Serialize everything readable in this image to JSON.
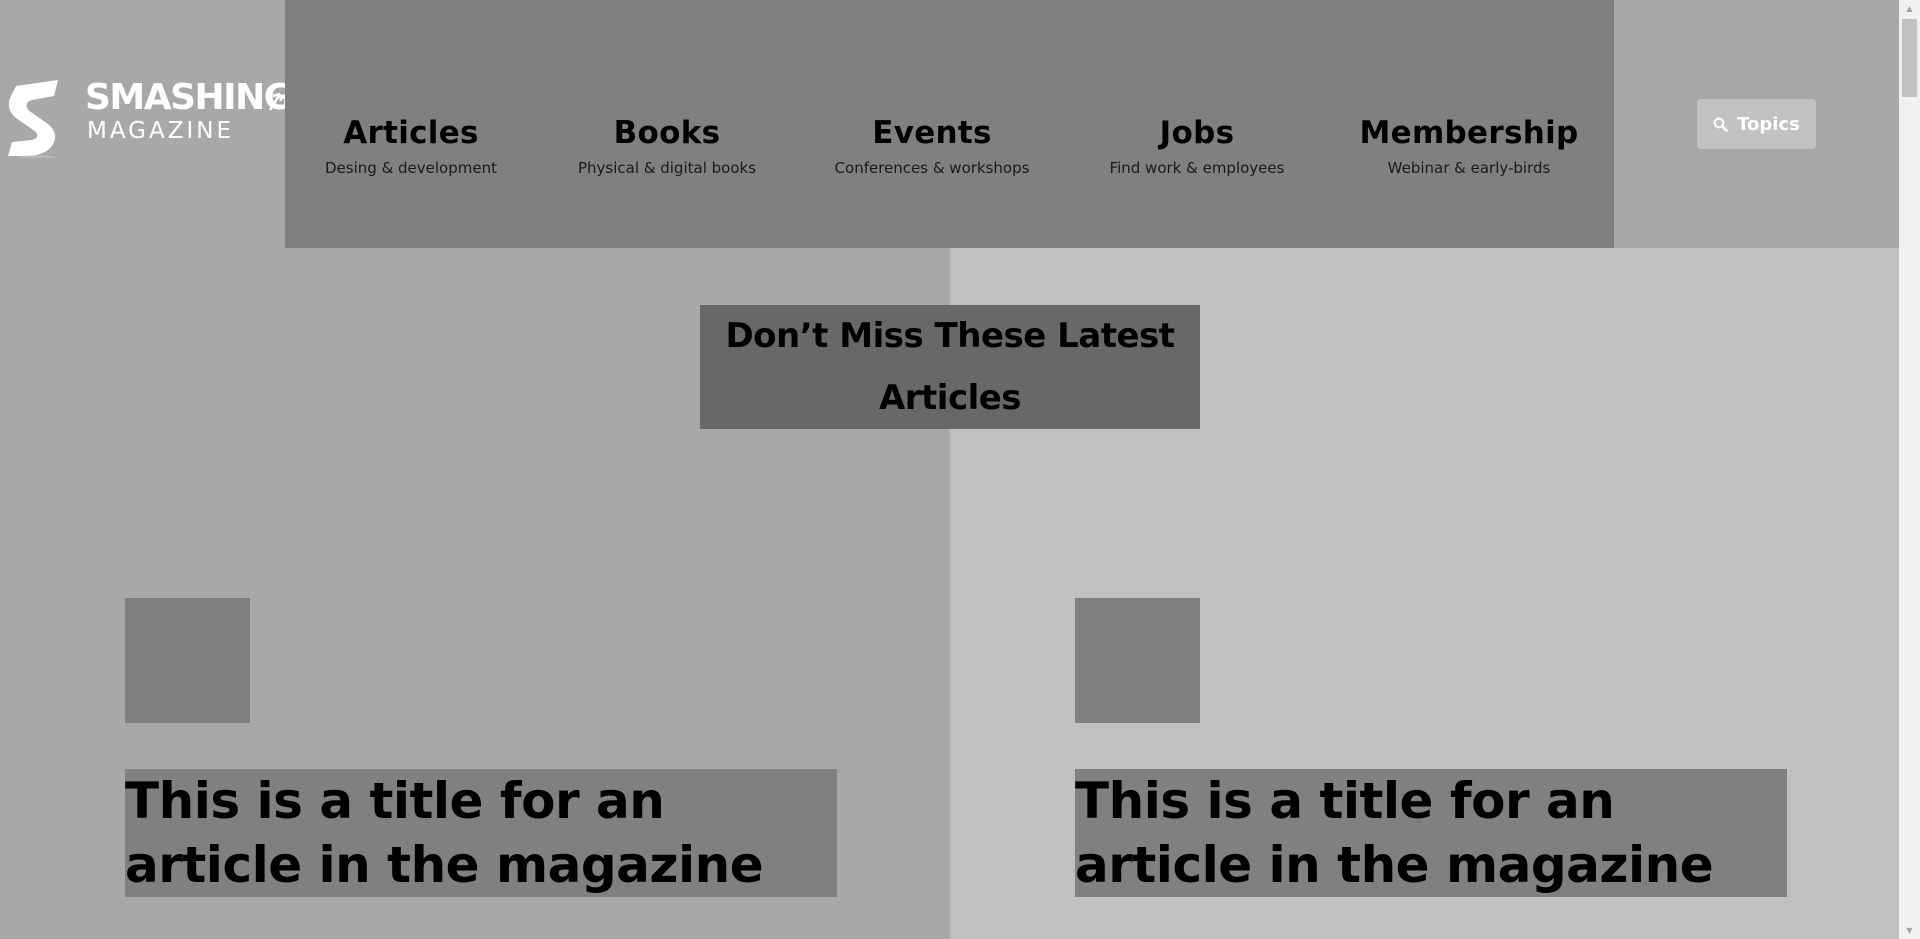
{
  "logo": {
    "title": "SMASHING",
    "subtitle": "MAGAZINE"
  },
  "nav": [
    {
      "label": "Articles",
      "desc": "Desing & development"
    },
    {
      "label": "Books",
      "desc": "Physical & digital books"
    },
    {
      "label": "Events",
      "desc": "Conferences & workshops"
    },
    {
      "label": "Jobs",
      "desc": "Find work & employees"
    },
    {
      "label": "Membership",
      "desc": "Webinar & early-birds"
    }
  ],
  "topics_button": {
    "label": "Topics",
    "icon": "search-icon"
  },
  "section": {
    "title": "Don’t Miss These Latest Articles"
  },
  "articles": [
    {
      "title": "This is a title for an article in the magazine"
    },
    {
      "title": "This is a title for an article in the magazine"
    }
  ],
  "colors": {
    "page_bg": "#a8a8a8",
    "nav_bg": "#808080",
    "right_half_bg": "#c0c0c0",
    "section_title_bg": "#686868",
    "block_bg": "#808080",
    "button_bg": "#c2c2c2"
  }
}
